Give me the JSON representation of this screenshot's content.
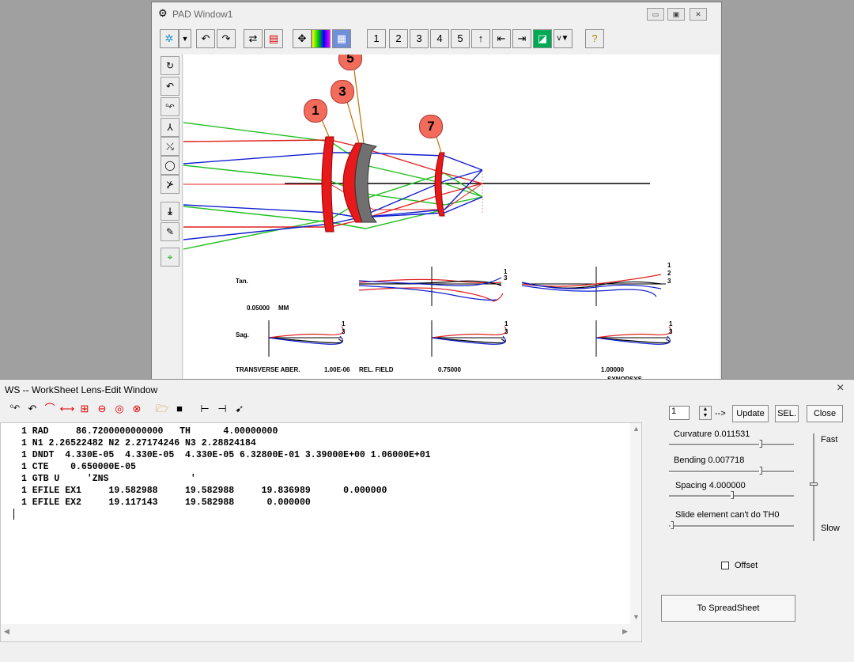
{
  "pad": {
    "title": "PAD Window1",
    "toolbar": {
      "view_numbers": [
        "1",
        "2",
        "3",
        "4",
        "5"
      ],
      "help_label": "?"
    },
    "canvas": {
      "element_labels": [
        "1",
        "3",
        "5",
        "7"
      ],
      "tan_label": "Tan.",
      "sag_label": "Sag.",
      "scale_value": "0.05000",
      "scale_unit": "MM",
      "footer_transverse": "TRANSVERSE ABER.",
      "footer_value": "1.00E-06",
      "footer_rel_field": "REL. FIELD",
      "field_075": "0.75000",
      "field_100": "1.00000",
      "synopsys": "SYNOPSYS",
      "curve_labels": [
        "1",
        "2",
        "3"
      ]
    },
    "colors": {
      "red": "#e02020",
      "green": "#20c020",
      "blue": "#1020d0",
      "lens_red": "#e8191b",
      "lens_gray": "#707070",
      "bubble": "#f26b5b"
    }
  },
  "ws": {
    "title": "WS -- WorkSheet Lens-Edit Window",
    "close_label": "×",
    "lines": [
      "1 RAD     86.7200000000000   TH      4.00000000",
      "1 N1 2.26522482 N2 2.27174246 N3 2.28824184",
      "1 DNDT  4.330E-05  4.330E-05  4.330E-05 6.32800E-01 3.39000E+00 1.06000E+01",
      "1 CTE    0.650000E-05",
      "1 GTB U     'ZNS               '",
      "1 EFILE EX1     19.582988     19.582988     19.836989      0.000000",
      "1 EFILE EX2     19.117143     19.582988      0.000000"
    ],
    "panel": {
      "surface_value": "1",
      "arrow_text": "-->",
      "update_label": "Update",
      "sel_label": "SEL.",
      "close_label": "Close",
      "curvature_label": "Curvature 0.011531",
      "bending_label": "Bending  0.007718",
      "spacing_label": "Spacing 4.000000",
      "slide_label": "Slide element   can't do TH0",
      "fast_label": "Fast",
      "slow_label": "Slow",
      "offset_label": "Offset",
      "spreadsheet_label": "To SpreadSheet"
    }
  }
}
